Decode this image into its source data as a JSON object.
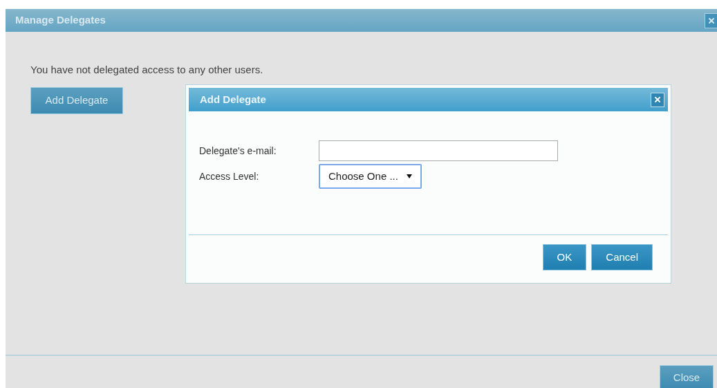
{
  "window": {
    "title": "Manage Delegates"
  },
  "message": "You have not delegated access to any other users.",
  "add_button": "Add Delegate",
  "dialog": {
    "title": "Add Delegate",
    "fields": [
      {
        "kind": "text",
        "label": "Delegate's e-mail:"
      },
      {
        "kind": "select",
        "label": "Access Level:",
        "value": "Choose One ..."
      }
    ],
    "buttons": [
      "OK",
      "Cancel"
    ]
  },
  "close_button": "Close"
}
